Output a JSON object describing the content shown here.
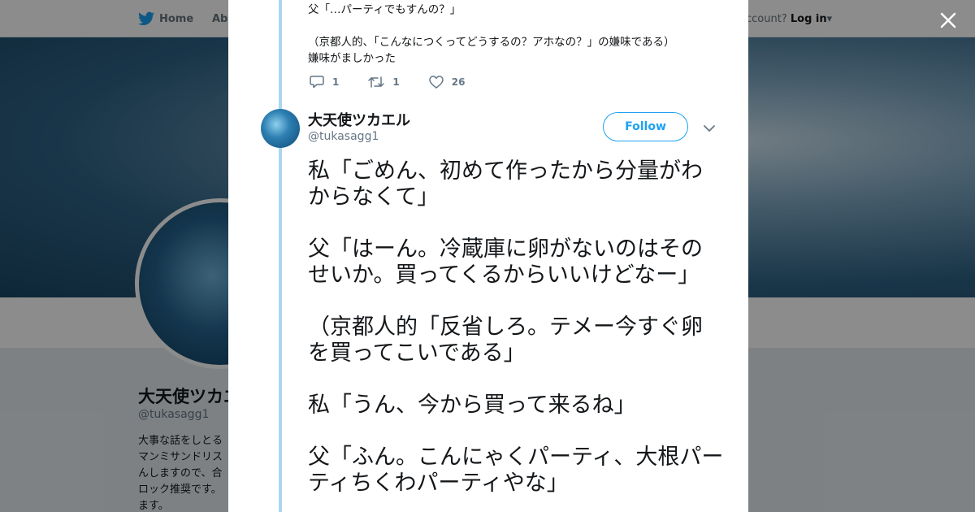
{
  "background_page": {
    "nav": {
      "home": "Home",
      "about": "Abo",
      "account": "ccount?",
      "login": "Log in"
    },
    "profile": {
      "name": "大天使ツカエ",
      "handle": "@tukasagg1",
      "bio_lines": [
        "大事な話をしとる",
        "マンミサンドリス",
        "んしますので、合",
        "ロック推奨です。",
        "ます。"
      ]
    }
  },
  "previous_tweet": {
    "lines": [
      "父「…パーティでもすんの？」",
      "",
      "（京都人的、「こんなにつくってどうするの？アホなの？」の嫌味である）",
      "嫌味がましかった"
    ],
    "replies": "1",
    "retweets": "1",
    "likes": "26"
  },
  "tweet": {
    "name": "大天使ツカエル",
    "handle": "@tukasagg1",
    "follow_label": "Follow",
    "text": "私「ごめん、初めて作ったから分量がわからなくて」\n\n父「はーん。冷蔵庫に卵がないのはそのせいか。買ってくるからいいけどなー」\n\n（京都人的「反省しろ。テメー今すぐ卵を買ってこいである」\n\n私「うん、今から買って来るね」\n\n父「ふん。こんにゃくパーティ、大根パーティちくわパーティやな」"
  },
  "colors": {
    "accent": "#1da1f2",
    "thread": "#a8d7f2",
    "text": "#14171a",
    "muted": "#657786"
  },
  "icons": [
    "twitter-bird-icon",
    "close-icon",
    "reply-icon",
    "retweet-icon",
    "heart-icon",
    "chevron-down-icon"
  ]
}
